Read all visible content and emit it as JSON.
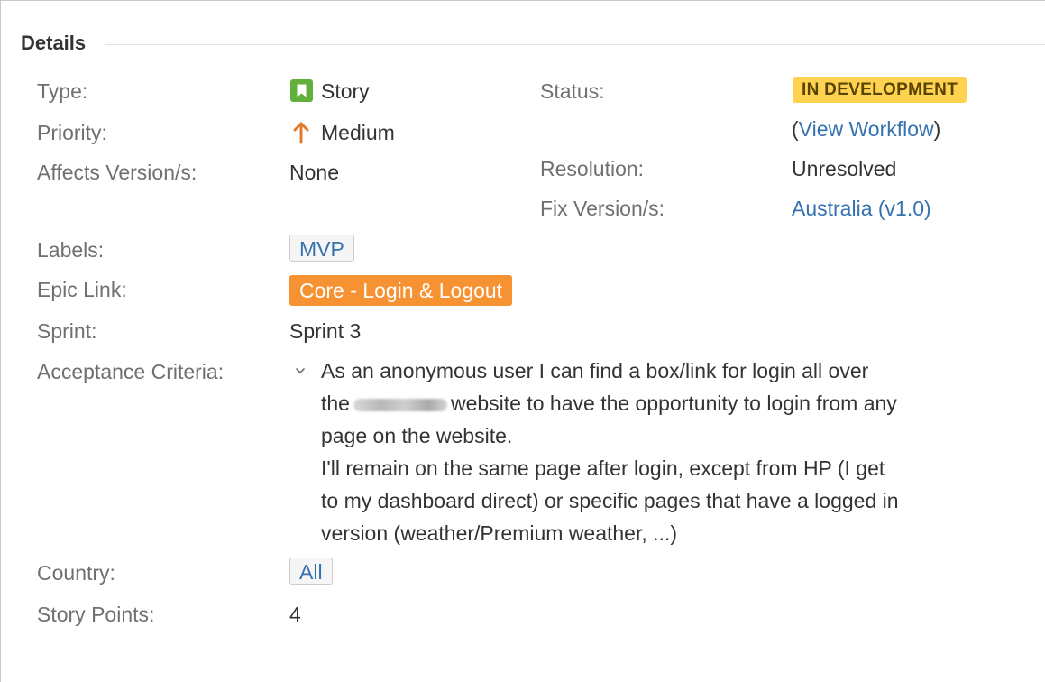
{
  "section": {
    "title": "Details"
  },
  "fields": {
    "type": {
      "label": "Type:",
      "value": "Story",
      "icon": "story-icon"
    },
    "priority": {
      "label": "Priority:",
      "value": "Medium",
      "icon": "arrow-up-icon",
      "color": "#e07b2c"
    },
    "affects_versions": {
      "label": "Affects Version/s:",
      "value": "None"
    },
    "status": {
      "label": "Status:",
      "value": "IN DEVELOPMENT",
      "color": "#ffd351"
    },
    "workflow": {
      "open_paren": "(",
      "link": "View Workflow",
      "close_paren": ")"
    },
    "resolution": {
      "label": "Resolution:",
      "value": "Unresolved"
    },
    "fix_versions": {
      "label": "Fix Version/s:",
      "value": "Australia (v1.0)"
    },
    "labels": {
      "label": "Labels:",
      "value": "MVP"
    },
    "epic_link": {
      "label": "Epic Link:",
      "value": "Core - Login & Logout",
      "color": "#f79232"
    },
    "sprint": {
      "label": "Sprint:",
      "value": "Sprint 3"
    },
    "acceptance_criteria": {
      "label": "Acceptance Criteria:",
      "line1": "As an anonymous user I can find a box/link for login all over",
      "line2_start": "the",
      "line2_end": "website to have the opportunity to login from any",
      "line3": "page on the website.",
      "line4": "I'll remain on the same page after login, except from HP (I get",
      "line5": "to my dashboard direct) or specific pages that have a logged in",
      "line6": "version (weather/Premium weather, ...)"
    },
    "country": {
      "label": "Country:",
      "value": "All"
    },
    "story_points": {
      "label": "Story Points:",
      "value": "4"
    }
  },
  "colors": {
    "link": "#3572b0",
    "label": "#707070",
    "text": "#333333"
  }
}
